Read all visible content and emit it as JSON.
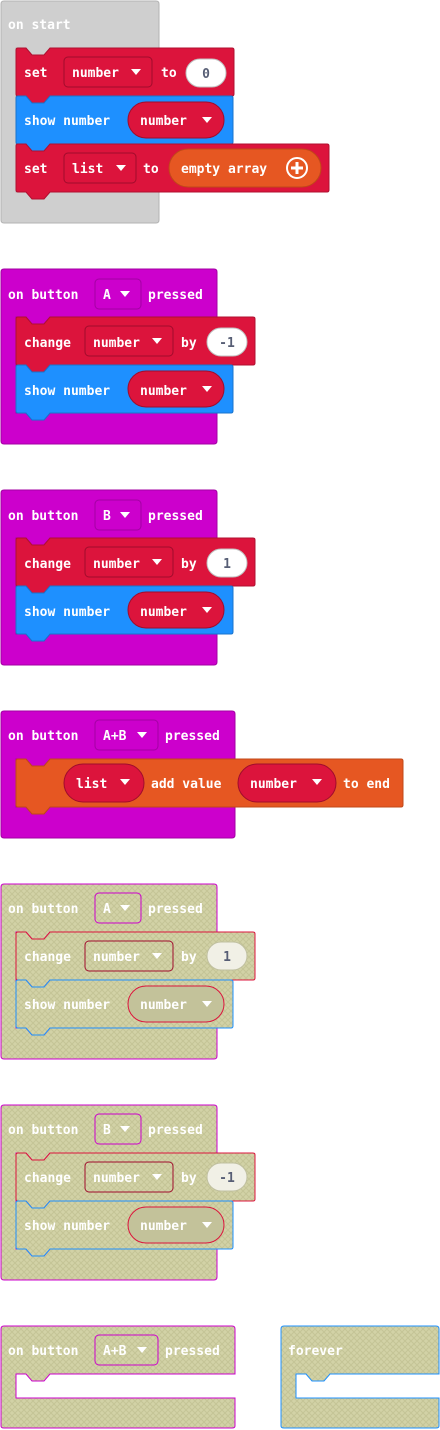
{
  "colors": {
    "events": "#cc00cc",
    "variables": "#dc143c",
    "basic": "#1e90ff",
    "arrays": "#e65722",
    "loops": "#cfcfcf",
    "disabled": "#d1d0a8"
  },
  "blocks": {
    "on_start": {
      "title": "on start",
      "set_number": {
        "kw_set": "set",
        "var": "number",
        "kw_to": "to",
        "value": "0"
      },
      "show_number": {
        "label": "show number",
        "var": "number"
      },
      "set_list": {
        "kw_set": "set",
        "var": "list",
        "kw_to": "to",
        "value": "empty array"
      }
    },
    "button_a": {
      "kw_on": "on button",
      "button": "A",
      "kw_pressed": "pressed",
      "change": {
        "kw_change": "change",
        "var": "number",
        "kw_by": "by",
        "value": "-1"
      },
      "show": {
        "label": "show number",
        "var": "number"
      }
    },
    "button_b": {
      "kw_on": "on button",
      "button": "B",
      "kw_pressed": "pressed",
      "change": {
        "kw_change": "change",
        "var": "number",
        "kw_by": "by",
        "value": "1"
      },
      "show": {
        "label": "show number",
        "var": "number"
      }
    },
    "button_ab": {
      "kw_on": "on button",
      "button": "A+B",
      "kw_pressed": "pressed",
      "add": {
        "var": "list",
        "kw_add": "add value",
        "value_var": "number",
        "kw_end": "to end"
      }
    },
    "dis_button_a": {
      "kw_on": "on button",
      "button": "A",
      "kw_pressed": "pressed",
      "change": {
        "kw_change": "change",
        "var": "number",
        "kw_by": "by",
        "value": "1"
      },
      "show": {
        "label": "show number",
        "var": "number"
      }
    },
    "dis_button_b": {
      "kw_on": "on button",
      "button": "B",
      "kw_pressed": "pressed",
      "change": {
        "kw_change": "change",
        "var": "number",
        "kw_by": "by",
        "value": "-1"
      },
      "show": {
        "label": "show number",
        "var": "number"
      }
    },
    "dis_button_ab": {
      "kw_on": "on button",
      "button": "A+B",
      "kw_pressed": "pressed"
    },
    "forever": {
      "title": "forever"
    }
  },
  "icons": {
    "dropdown": "triangle-down",
    "add": "plus-circle"
  }
}
